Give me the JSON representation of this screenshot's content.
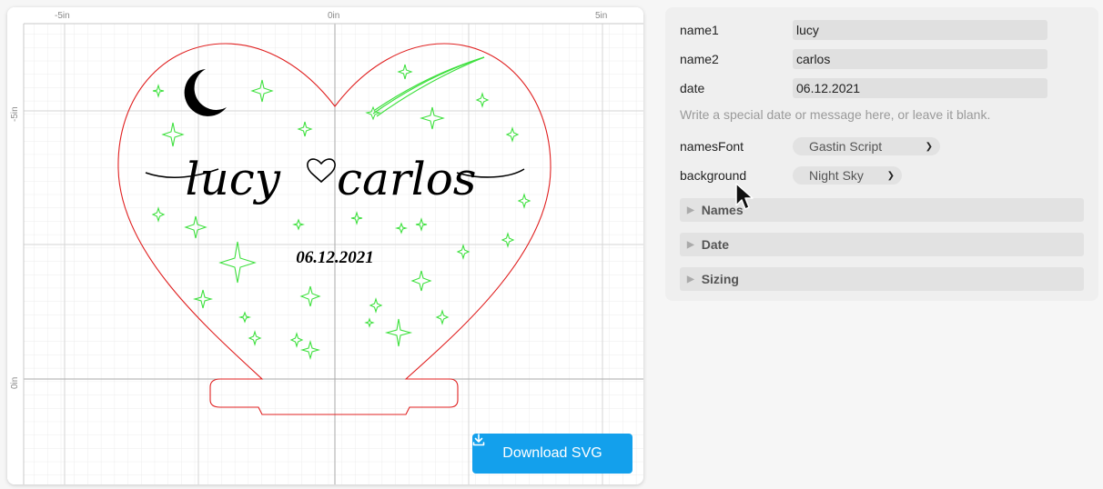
{
  "ruler": {
    "top_labels": [
      "-5in",
      "0in",
      "5in"
    ],
    "left_labels": [
      "-5in",
      "0in"
    ]
  },
  "design": {
    "name1": "lucy",
    "name2": "carlos",
    "date": "06.12.2021"
  },
  "download_button": {
    "label": "Download SVG",
    "icon": "download-icon"
  },
  "settings": {
    "name1": {
      "label": "name1",
      "value": "lucy"
    },
    "name2": {
      "label": "name2",
      "value": "carlos"
    },
    "date": {
      "label": "date",
      "value": "06.12.2021"
    },
    "hint": "Write a special date or message here, or leave it blank.",
    "namesFont": {
      "label": "namesFont",
      "value": "Gastin Script"
    },
    "background": {
      "label": "background",
      "value": "Night Sky"
    },
    "sections": [
      "Names",
      "Date",
      "Sizing"
    ]
  },
  "colors": {
    "cut_line": "#e02020",
    "stars": "#3ee03e",
    "button": "#13a0ec"
  }
}
